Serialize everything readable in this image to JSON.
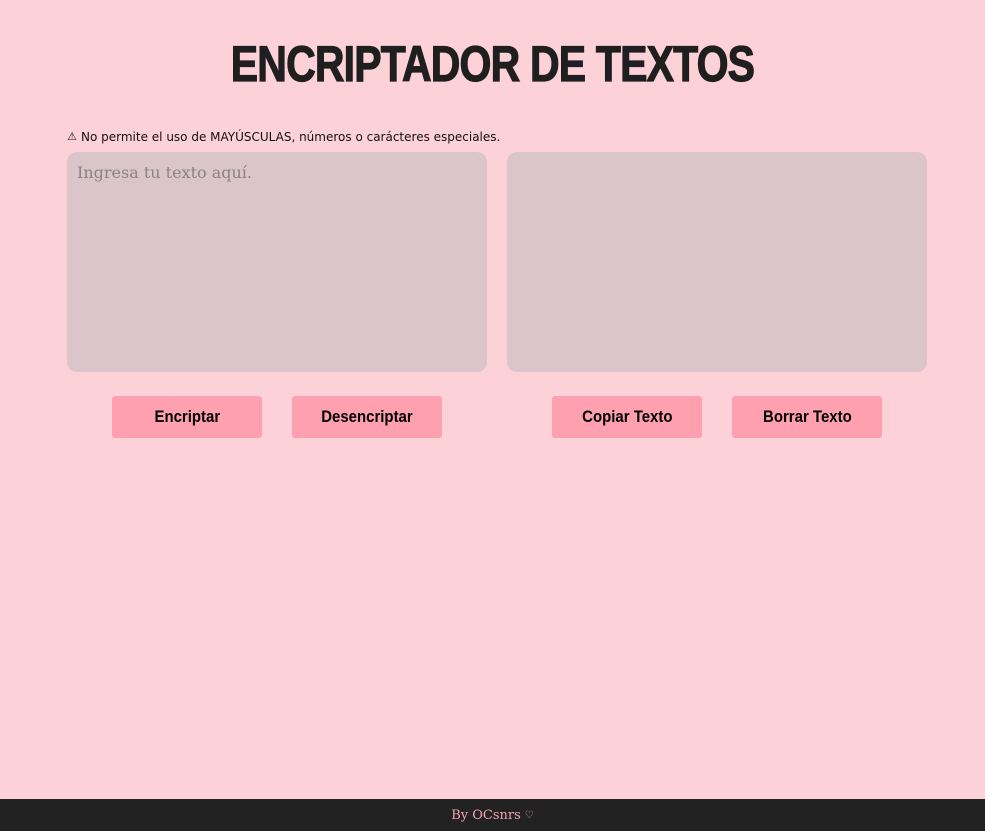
{
  "page": {
    "title": "ENCRIPTADOR DE TEXTOS",
    "background_color": "#fcd1d8"
  },
  "warning": {
    "icon": "warning-triangle-icon",
    "text": "No permite el uso de MAYÚSCULAS, números o carácteres especiales."
  },
  "input": {
    "placeholder": "Ingresa tu texto aquí.",
    "value": ""
  },
  "output": {
    "value": ""
  },
  "buttons": {
    "encrypt_label": "Encriptar",
    "decrypt_label": "Desencriptar",
    "copy_label": "Copiar Texto",
    "clear_label": "Borrar Texto",
    "color": "#ffa0b0"
  },
  "footer": {
    "text": "By OCsnrs",
    "icon": "heart-icon",
    "background_color": "#222222",
    "text_color": "#f4a3b3"
  }
}
